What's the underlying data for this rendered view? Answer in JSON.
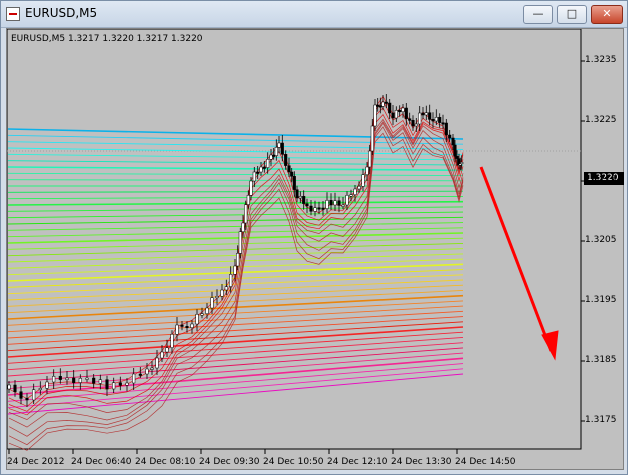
{
  "window": {
    "title": "EURUSD,M5",
    "controls": {
      "minimize": "—",
      "maximize": "□",
      "close": "✕"
    }
  },
  "chart": {
    "info": "EURUSD,M5  1.3217 1.3220 1.3217 1.3220",
    "current_price": "1.3220",
    "price_labels": [
      "1.3235",
      "1.3225",
      "1.3215",
      "1.3205",
      "1.3195",
      "1.3185",
      "1.3175"
    ],
    "time_labels": [
      "24 Dec 2012",
      "24 Dec 06:40",
      "24 Dec 08:10",
      "24 Dec 09:30",
      "24 Dec 10:50",
      "24 Dec 12:10",
      "24 Dec 13:30",
      "24 Dec 14:50"
    ],
    "colors": {
      "background": "#c0c0c0",
      "candle": "#000000",
      "arrow": "#ff0000"
    }
  }
}
